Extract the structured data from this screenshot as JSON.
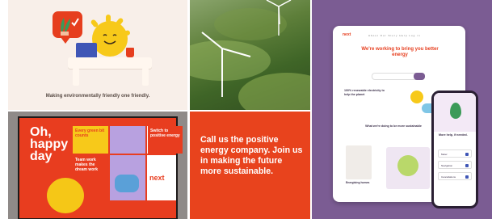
{
  "tile_illustration": {
    "caption": "Making environmentally friendly one friendly."
  },
  "tile_billboard": {
    "headline": "Oh, happy day",
    "panel_1": "Every green bit counts",
    "panel_2": "Switch to positive energy",
    "panel_3": "Team work makes the dream work",
    "brand": "next"
  },
  "tile_statement": {
    "text": "Call us the positive energy company. Join us in making the future more sustainable."
  },
  "tile_website": {
    "logo": "next",
    "nav": "About   Our Story   Help   Log in",
    "headline": "We're working to bring you better energy",
    "section_1": "100% renewable electricity to help the planet",
    "section_2": "What we're doing to be more sustainable",
    "card_title": "Energising homes",
    "phone_title": "More help, if needed.",
    "phone_rows": [
      "Meter",
      "Navigation",
      "Cancellations"
    ]
  },
  "colors": {
    "brand_orange": "#e8431d",
    "brand_purple": "#7b5c93",
    "sun_yellow": "#f7c91a"
  }
}
